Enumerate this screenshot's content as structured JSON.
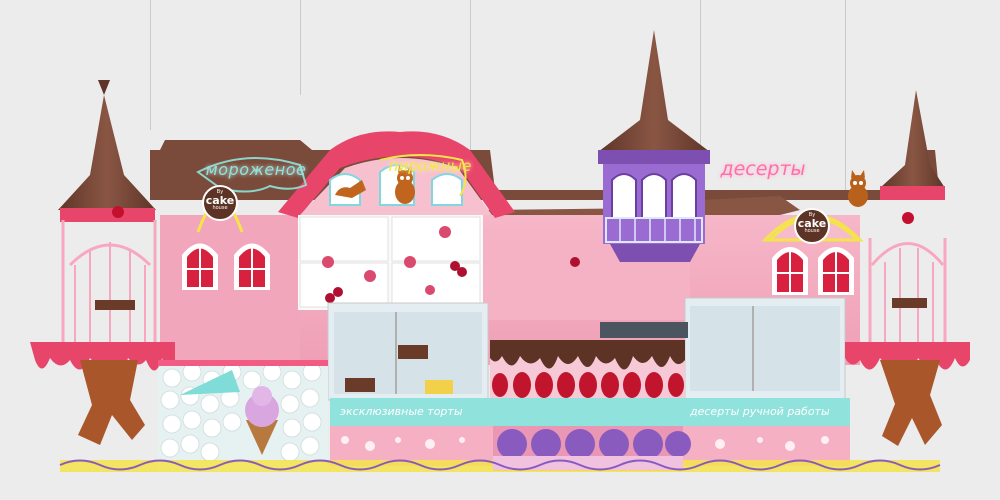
{
  "signs": {
    "neon_left": "мороженое",
    "neon_center": "пирожные",
    "neon_right": "десерты",
    "logo_left_top": "By",
    "logo_left_main": "cake",
    "logo_left_bottom": "house",
    "logo_right_top": "By",
    "logo_right_main": "cake",
    "logo_right_bottom": "house",
    "counter_left": "эксклюзивные торты",
    "counter_right": "десерты ручной работы"
  },
  "colors": {
    "wall_pink": "#f3a9bd",
    "roof_brown": "#7a4a3a",
    "mint": "#8fe3dc",
    "purple": "#8a5bbf",
    "cream": "#fbe9ef",
    "red_trim": "#e8456a",
    "neon_yellow": "#f4e44a",
    "neon_pink": "#ff6fa8"
  }
}
